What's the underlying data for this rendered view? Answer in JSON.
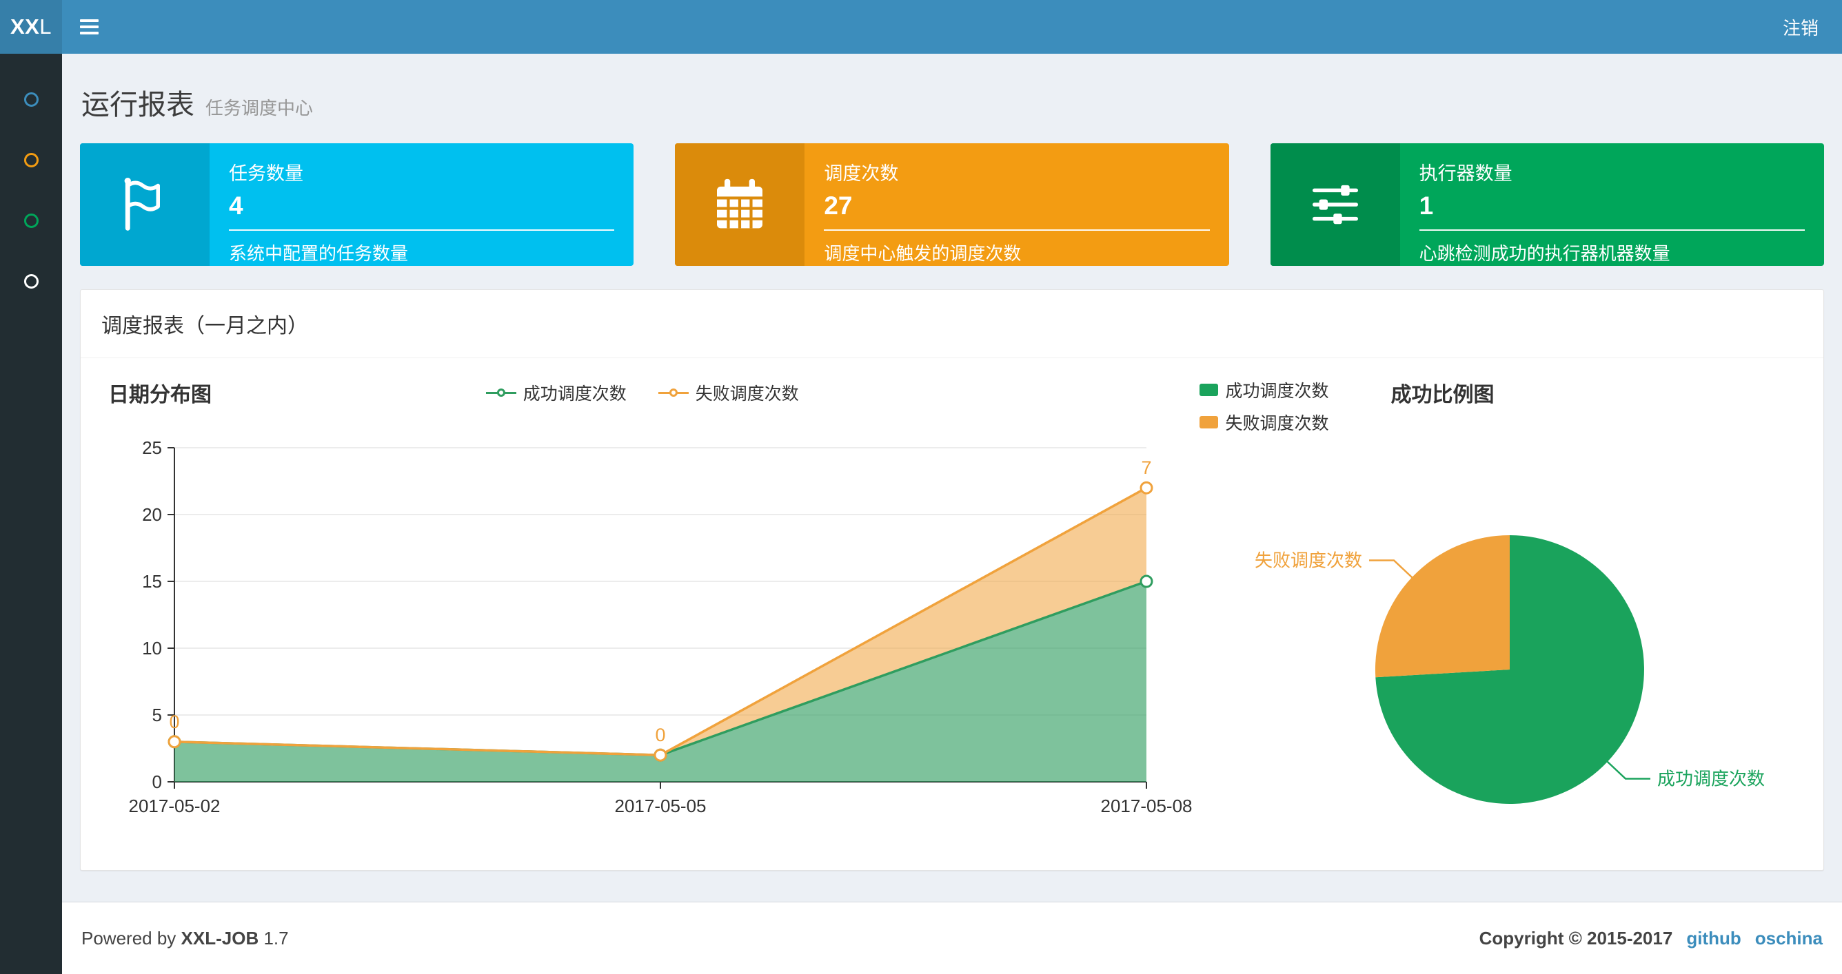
{
  "colors": {
    "navbar_bg": "#3c8dbc",
    "logo_bg": "#367fa9",
    "sidebar_bg": "#222d32",
    "content_bg": "#ecf0f5",
    "link": "#3c8dbc"
  },
  "navbar": {
    "logo_bold": "XX",
    "logo_rest": "L",
    "logout_label": "注销"
  },
  "sidebar": {
    "items": [
      {
        "icon": "circle-o-icon",
        "icon_color": "#3c8dbc"
      },
      {
        "icon": "circle-o-icon",
        "icon_color": "#f39c12"
      },
      {
        "icon": "circle-o-icon",
        "icon_color": "#00a65a"
      },
      {
        "icon": "circle-o-icon",
        "icon_color": "#ffffff"
      }
    ]
  },
  "page_header": {
    "title": "运行报表",
    "subtitle": "任务调度中心"
  },
  "info_boxes": [
    {
      "icon": "flag-icon",
      "title": "任务数量",
      "value": "4",
      "caption": "系统中配置的任务数量",
      "bg": "#00c0ef",
      "icon_bg": "#00a7d0"
    },
    {
      "icon": "calendar-icon",
      "title": "调度次数",
      "value": "27",
      "caption": "调度中心触发的调度次数",
      "bg": "#f39c12",
      "icon_bg": "#db8b0b"
    },
    {
      "icon": "sliders-icon",
      "title": "执行器数量",
      "value": "1",
      "caption": "心跳检测成功的执行器机器数量",
      "bg": "#00a65a",
      "icon_bg": "#008d4c"
    }
  ],
  "panel": {
    "title": "调度报表（一月之内）"
  },
  "chart_data": [
    {
      "type": "area",
      "title": "日期分布图",
      "stacked": true,
      "grid": true,
      "legend_position": "top-center",
      "categories": [
        "2017-05-02",
        "2017-05-05",
        "2017-05-08"
      ],
      "series": [
        {
          "name": "成功调度次数",
          "values": [
            3,
            2,
            15
          ],
          "color": "#2f9d5f"
        },
        {
          "name": "失败调度次数",
          "values": [
            0,
            0,
            7
          ],
          "color": "#f0a23c"
        }
      ],
      "point_labels_series": "失败调度次数",
      "point_labels": [
        0,
        0,
        7
      ],
      "ylim": [
        0,
        25
      ],
      "ytick_step": 5
    },
    {
      "type": "pie",
      "title": "成功比例图",
      "legend_position": "top-left",
      "start_angle": "top",
      "direction": "clockwise",
      "slices": [
        {
          "label": "成功调度次数",
          "value": 20,
          "color": "#1aa35c"
        },
        {
          "label": "失败调度次数",
          "value": 7,
          "color": "#f0a23c"
        }
      ]
    }
  ],
  "footer": {
    "powered_prefix": "Powered by",
    "product": "XXL-JOB",
    "version": "1.7",
    "copyright": "Copyright © 2015-2017",
    "links": [
      {
        "label": "github"
      },
      {
        "label": "oschina"
      }
    ]
  }
}
